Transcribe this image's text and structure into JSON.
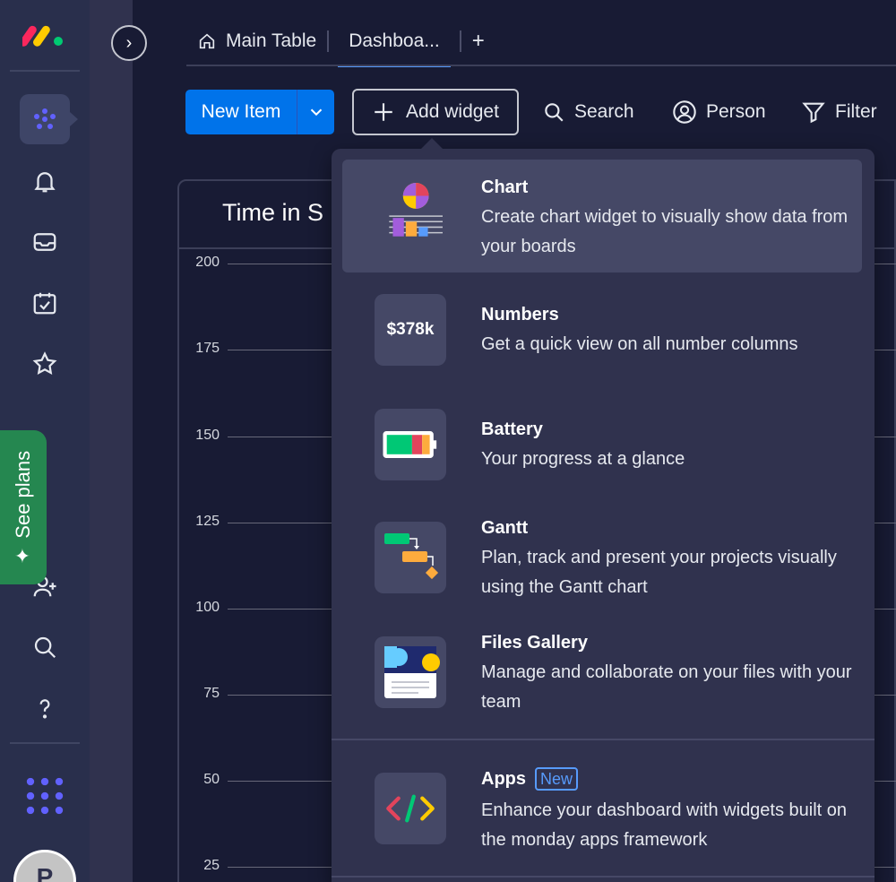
{
  "app": {
    "logo": "monday-logo"
  },
  "rail": {
    "see_plans_label": "See plans"
  },
  "tabs": [
    {
      "label": "Main Table",
      "icon": "home-icon"
    },
    {
      "label": "Dashboa...",
      "active": true
    },
    {
      "label": "+"
    }
  ],
  "toolbar": {
    "new_item_label": "New Item",
    "add_widget_label": "Add widget",
    "search_label": "Search",
    "person_label": "Person",
    "filter_label": "Filter"
  },
  "widget": {
    "title": "Time in S",
    "y_ticks": [
      "200",
      "175",
      "150",
      "125",
      "100",
      "75",
      "50",
      "25"
    ]
  },
  "menu": {
    "items": [
      {
        "title": "Chart",
        "desc": "Create chart widget to visually show data from your boards",
        "icon": "chart-widget-icon"
      },
      {
        "title": "Numbers",
        "desc": "Get a quick view on all number columns",
        "icon_text": "$378k",
        "icon": "numbers-widget-icon"
      },
      {
        "title": "Battery",
        "desc": "Your progress at a glance",
        "icon": "battery-widget-icon"
      },
      {
        "title": "Gantt",
        "desc": "Plan, track and present your projects visually using the Gantt chart",
        "icon": "gantt-widget-icon"
      },
      {
        "title": "Files Gallery",
        "desc": "Manage and collaborate on your files with your team",
        "icon": "files-gallery-icon"
      },
      {
        "title": "Apps",
        "badge": "New",
        "desc": "Enhance your dashboard with widgets built on the monday apps framework",
        "icon": "code-apps-icon"
      }
    ]
  },
  "user": {
    "avatar_initial": "P"
  },
  "colors": {
    "accent": "#0073ea",
    "rail": "#292f4c",
    "menu": "#30324e",
    "see_plans": "#258750"
  }
}
